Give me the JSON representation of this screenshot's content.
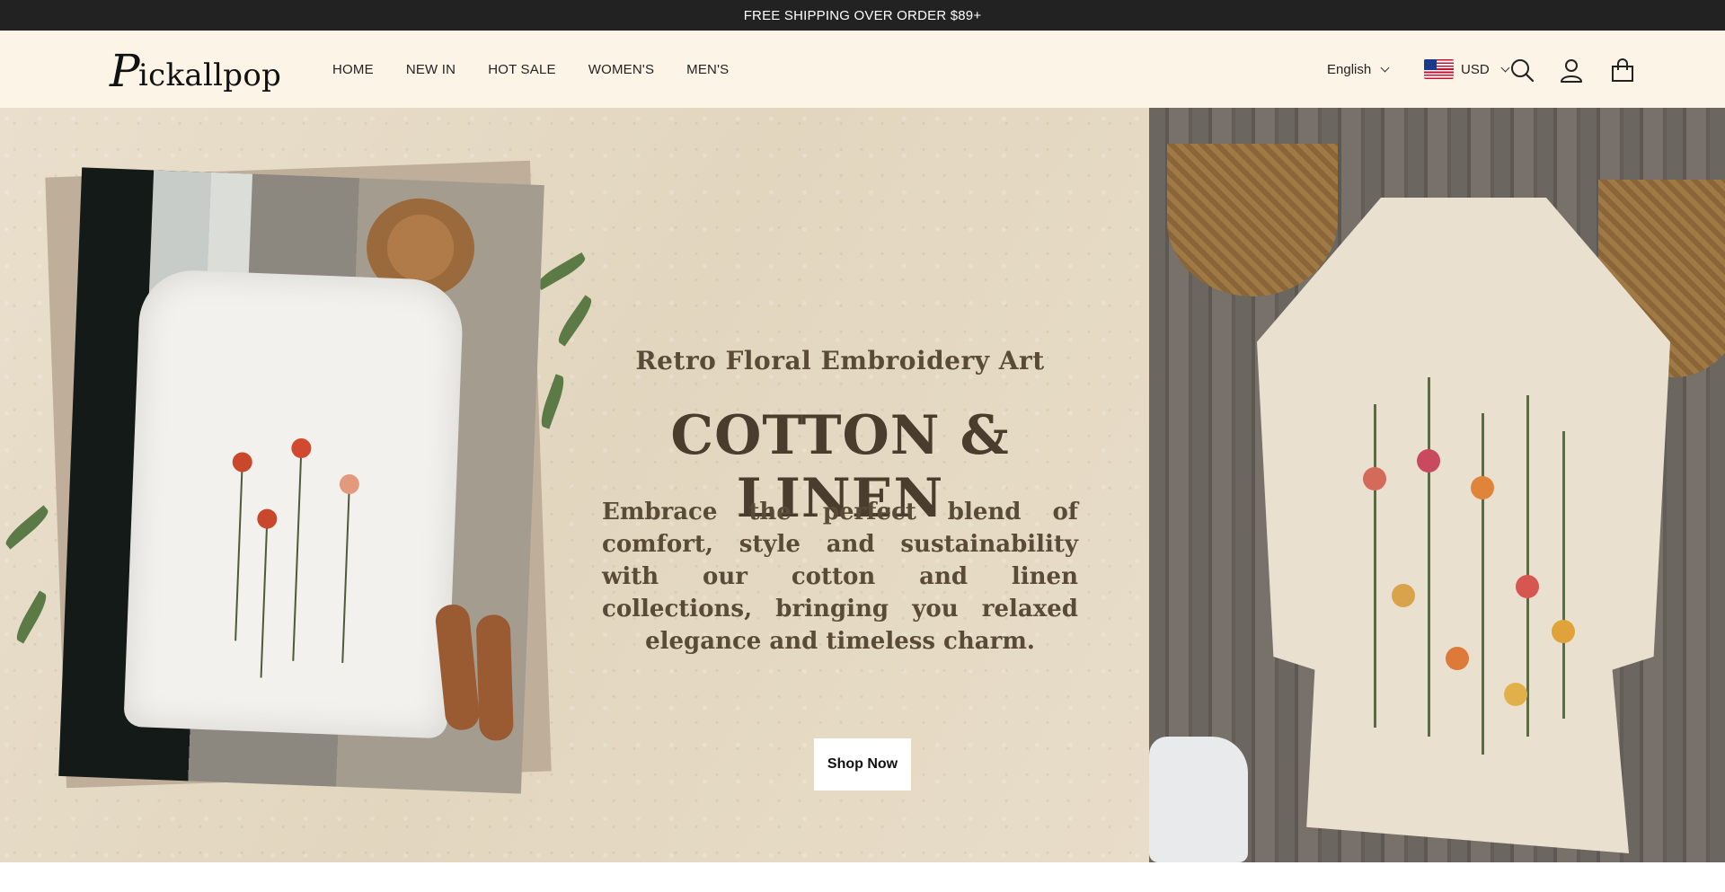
{
  "announcement": {
    "text": "FREE SHIPPING OVER ORDER $89+"
  },
  "header": {
    "logo_initial": "P",
    "logo_rest": "ickallpop",
    "nav": [
      "HOME",
      "NEW IN",
      "HOT SALE",
      "WOMEN'S",
      "MEN'S"
    ],
    "language": "English",
    "currency": "USD",
    "icons": [
      "chevron-down-icon",
      "us-flag-icon",
      "search-icon",
      "user-icon",
      "shopping-bag-icon"
    ]
  },
  "hero": {
    "subtitle": "Retro Floral Embroidery Art",
    "title": "COTTON & LINEN",
    "description": "Embrace the perfect blend of comfort, style and sustainability with our cotton and linen collections, bringing you relaxed elegance and timeless charm.",
    "cta": "Shop Now"
  },
  "colors": {
    "announcement_bg": "#222222",
    "header_bg": "#fdf4e8",
    "hero_bg": "#e6dbc6",
    "hero_text": "#4a3d2e",
    "button_bg": "#ffffff"
  }
}
